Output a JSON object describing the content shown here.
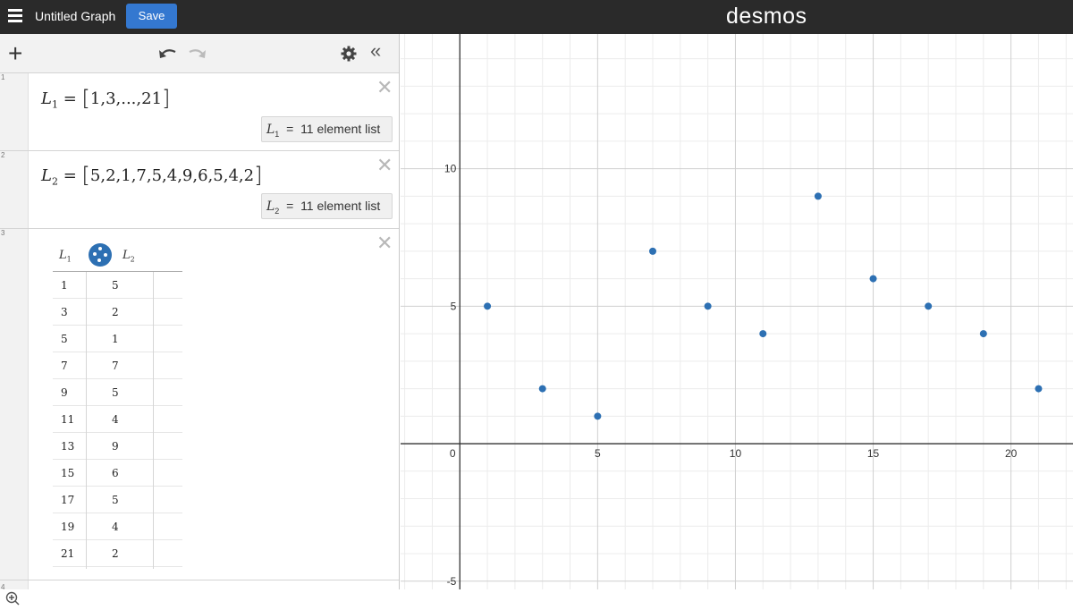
{
  "app": {
    "title": "Untitled Graph",
    "save_label": "Save",
    "logo": "desmos",
    "accent_color": "#3478d0",
    "point_color": "#2d70b3"
  },
  "toolbar": {
    "add_icon": "plus-icon",
    "undo_icon": "undo-icon",
    "redo_icon": "redo-icon",
    "settings_icon": "gear-icon",
    "collapse_icon": "double-chevron-left-icon"
  },
  "expressions": [
    {
      "index": "1",
      "var": "L",
      "sub": "1",
      "eq": "=",
      "values_text": "1,3,...,21",
      "eval_var": "L",
      "eval_sub": "1",
      "eval_eq": "=",
      "eval_text": "11 element list"
    },
    {
      "index": "2",
      "var": "L",
      "sub": "2",
      "eq": "=",
      "values_text": "5,2,1,7,5,4,9,6,5,4,2",
      "eval_var": "L",
      "eval_sub": "2",
      "eval_eq": "=",
      "eval_text": "11 element list"
    },
    {
      "index": "3"
    },
    {
      "index": "4"
    }
  ],
  "table": {
    "col1_var": "L",
    "col1_sub": "1",
    "col2_var": "L",
    "col2_sub": "2",
    "rows": [
      [
        "1",
        "5"
      ],
      [
        "3",
        "2"
      ],
      [
        "5",
        "1"
      ],
      [
        "7",
        "7"
      ],
      [
        "9",
        "5"
      ],
      [
        "11",
        "4"
      ],
      [
        "13",
        "9"
      ],
      [
        "15",
        "6"
      ],
      [
        "17",
        "5"
      ],
      [
        "19",
        "4"
      ],
      [
        "21",
        "2"
      ]
    ]
  },
  "chart_data": {
    "type": "scatter",
    "x": [
      1,
      3,
      5,
      7,
      9,
      11,
      13,
      15,
      17,
      19,
      21
    ],
    "y": [
      5,
      2,
      1,
      7,
      5,
      4,
      9,
      6,
      5,
      4,
      2
    ],
    "xlim": [
      -2.15,
      22.25
    ],
    "ylim": [
      -5.3,
      14.9
    ],
    "x_ticks": [
      "0",
      "5",
      "10",
      "15",
      "20"
    ],
    "y_ticks": [
      "10",
      "5",
      "-5"
    ],
    "grid": true,
    "color": "#2d70b3"
  }
}
